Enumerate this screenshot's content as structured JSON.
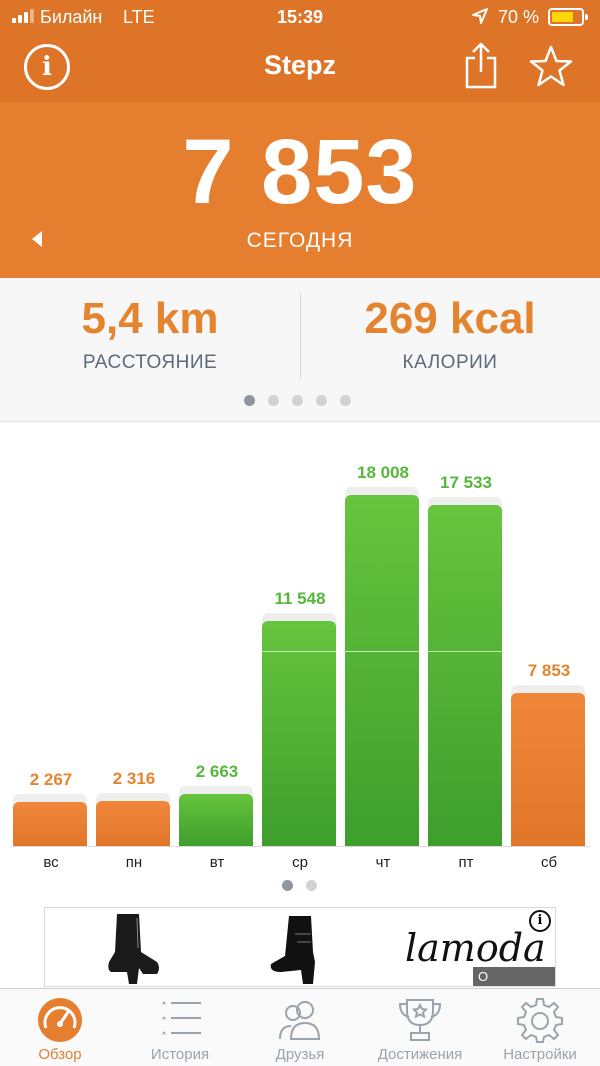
{
  "status_bar": {
    "carrier": "Билайн",
    "network": "LTE",
    "time": "15:39",
    "battery": "70 %",
    "battery_level": 0.7,
    "icons": [
      "signal-icon",
      "location-arrow-icon",
      "battery-icon"
    ]
  },
  "nav": {
    "title": "Stepz",
    "info_icon_glyph": "i",
    "icons": [
      "info-icon",
      "share-icon",
      "star-icon"
    ]
  },
  "today": {
    "steps": "7 853",
    "label": "СЕГОДНЯ"
  },
  "stats": {
    "distance_value": "5,4 km",
    "distance_label": "РАССТОЯНИЕ",
    "calories_value": "269 kcal",
    "calories_label": "КАЛОРИИ",
    "page_count": 5,
    "active_page": 0
  },
  "chart_data": {
    "type": "bar",
    "categories": [
      "вс",
      "пн",
      "вт",
      "ср",
      "чт",
      "пт",
      "сб"
    ],
    "values": [
      2267,
      2316,
      2663,
      11548,
      18008,
      17533,
      7853
    ],
    "value_labels": [
      "2 267",
      "2 316",
      "2 663",
      "11 548",
      "18 008",
      "17 533",
      "7 853"
    ],
    "bar_colors": [
      "orange",
      "orange",
      "green",
      "green",
      "green",
      "green",
      "orange"
    ],
    "ylim": [
      0,
      19000
    ],
    "goal_line": 10000,
    "colors": {
      "orange": "#e57e2f",
      "green": "#56b83a"
    },
    "page_count": 2,
    "active_page": 0
  },
  "ad": {
    "brand": "lamoda",
    "info_glyph": "i",
    "company_link": "О Компании"
  },
  "tabs": [
    {
      "label": "Обзор",
      "icon": "speedometer-icon",
      "active": true
    },
    {
      "label": "История",
      "icon": "list-icon",
      "active": false
    },
    {
      "label": "Друзья",
      "icon": "friends-icon",
      "active": false
    },
    {
      "label": "Достижения",
      "icon": "trophy-icon",
      "active": false
    },
    {
      "label": "Настройки",
      "icon": "gear-icon",
      "active": false
    }
  ],
  "colors": {
    "accent": "#e57e2f",
    "header_dark": "#dd7428",
    "label_gray": "#5c6a7c"
  }
}
